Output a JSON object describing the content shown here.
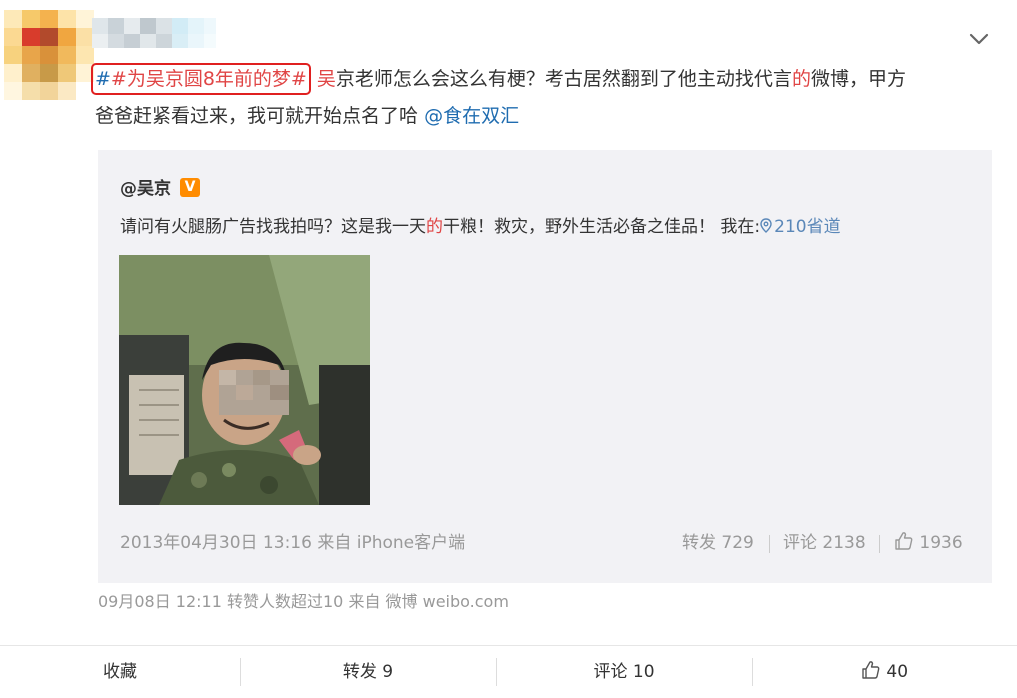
{
  "post": {
    "topic": "#为吴京圆8年前的梦#",
    "text_name": "吴",
    "text_part1": "京老师怎么会这么有梗？考古居然翻到了他主动找代言",
    "text_de": "的",
    "text_part2": "微博，甲方",
    "text_line2": "爸爸赶紧看过来，我可就开始点名了哈",
    "mention": "@食在双汇",
    "meta": "09月08日 12:11 转赞人数超过10  来自 微博 weibo.com"
  },
  "original": {
    "author": "@吴京",
    "badge": "V",
    "text_a": "请问有火腿肠广告找我拍吗？这是我一天",
    "text_de": "的",
    "text_b": "干粮！救灾，野外生活必备之佳品！ 我在:",
    "location": "210省道",
    "meta": "2013年04月30日 13:16 来自 iPhone客户端",
    "repost_label": "转发 729",
    "comment_label": "评论 2138",
    "like_count": "1936"
  },
  "actions": {
    "favorite": "收藏",
    "repost": "转发 9",
    "comment": "评论 10",
    "like": "40"
  },
  "icons": {
    "expand": "chevron-down-icon",
    "like": "thumbs-up-icon",
    "location": "location-pin-icon",
    "verified": "verified-badge-icon"
  },
  "colors": {
    "topic_border": "#e02020",
    "link": "#1f6cb0",
    "highlight": "#e04545",
    "card_bg": "#f2f2f5",
    "badge": "#ff8c00"
  }
}
